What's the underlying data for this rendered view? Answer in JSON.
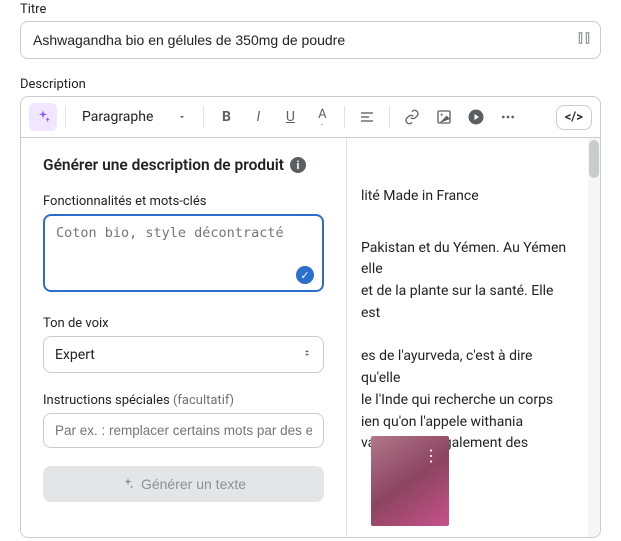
{
  "labels": {
    "title": "Titre",
    "description": "Description"
  },
  "title_value": "Ashwagandha bio en gélules de 350mg de poudre",
  "toolbar": {
    "paragraph": "Paragraphe",
    "code": "</>"
  },
  "ai_panel": {
    "heading": "Générer une description de produit",
    "keywords_label": "Fonctionnalités et mots-clés",
    "keywords_placeholder": "Coton bio, style décontracté",
    "tone_label": "Ton de voix",
    "tone_value": "Expert",
    "special_label": "Instructions spéciales",
    "special_optional": "(facultatif)",
    "special_placeholder": "Par ex. : remplacer certains mots par des en",
    "generate": "Générer un texte"
  },
  "content": {
    "line1": "lité Made in France",
    "line2": "Pakistan et du Yémen. Au Yémen elle",
    "line3": "et de la plante sur la santé. Elle est",
    "line4": "es de l'ayurveda, c'est à dire qu'elle",
    "line5": "le l'Inde qui recherche un corps",
    "line6": "ien qu'on l'appele withania",
    "line7": "vagandha a également des"
  }
}
